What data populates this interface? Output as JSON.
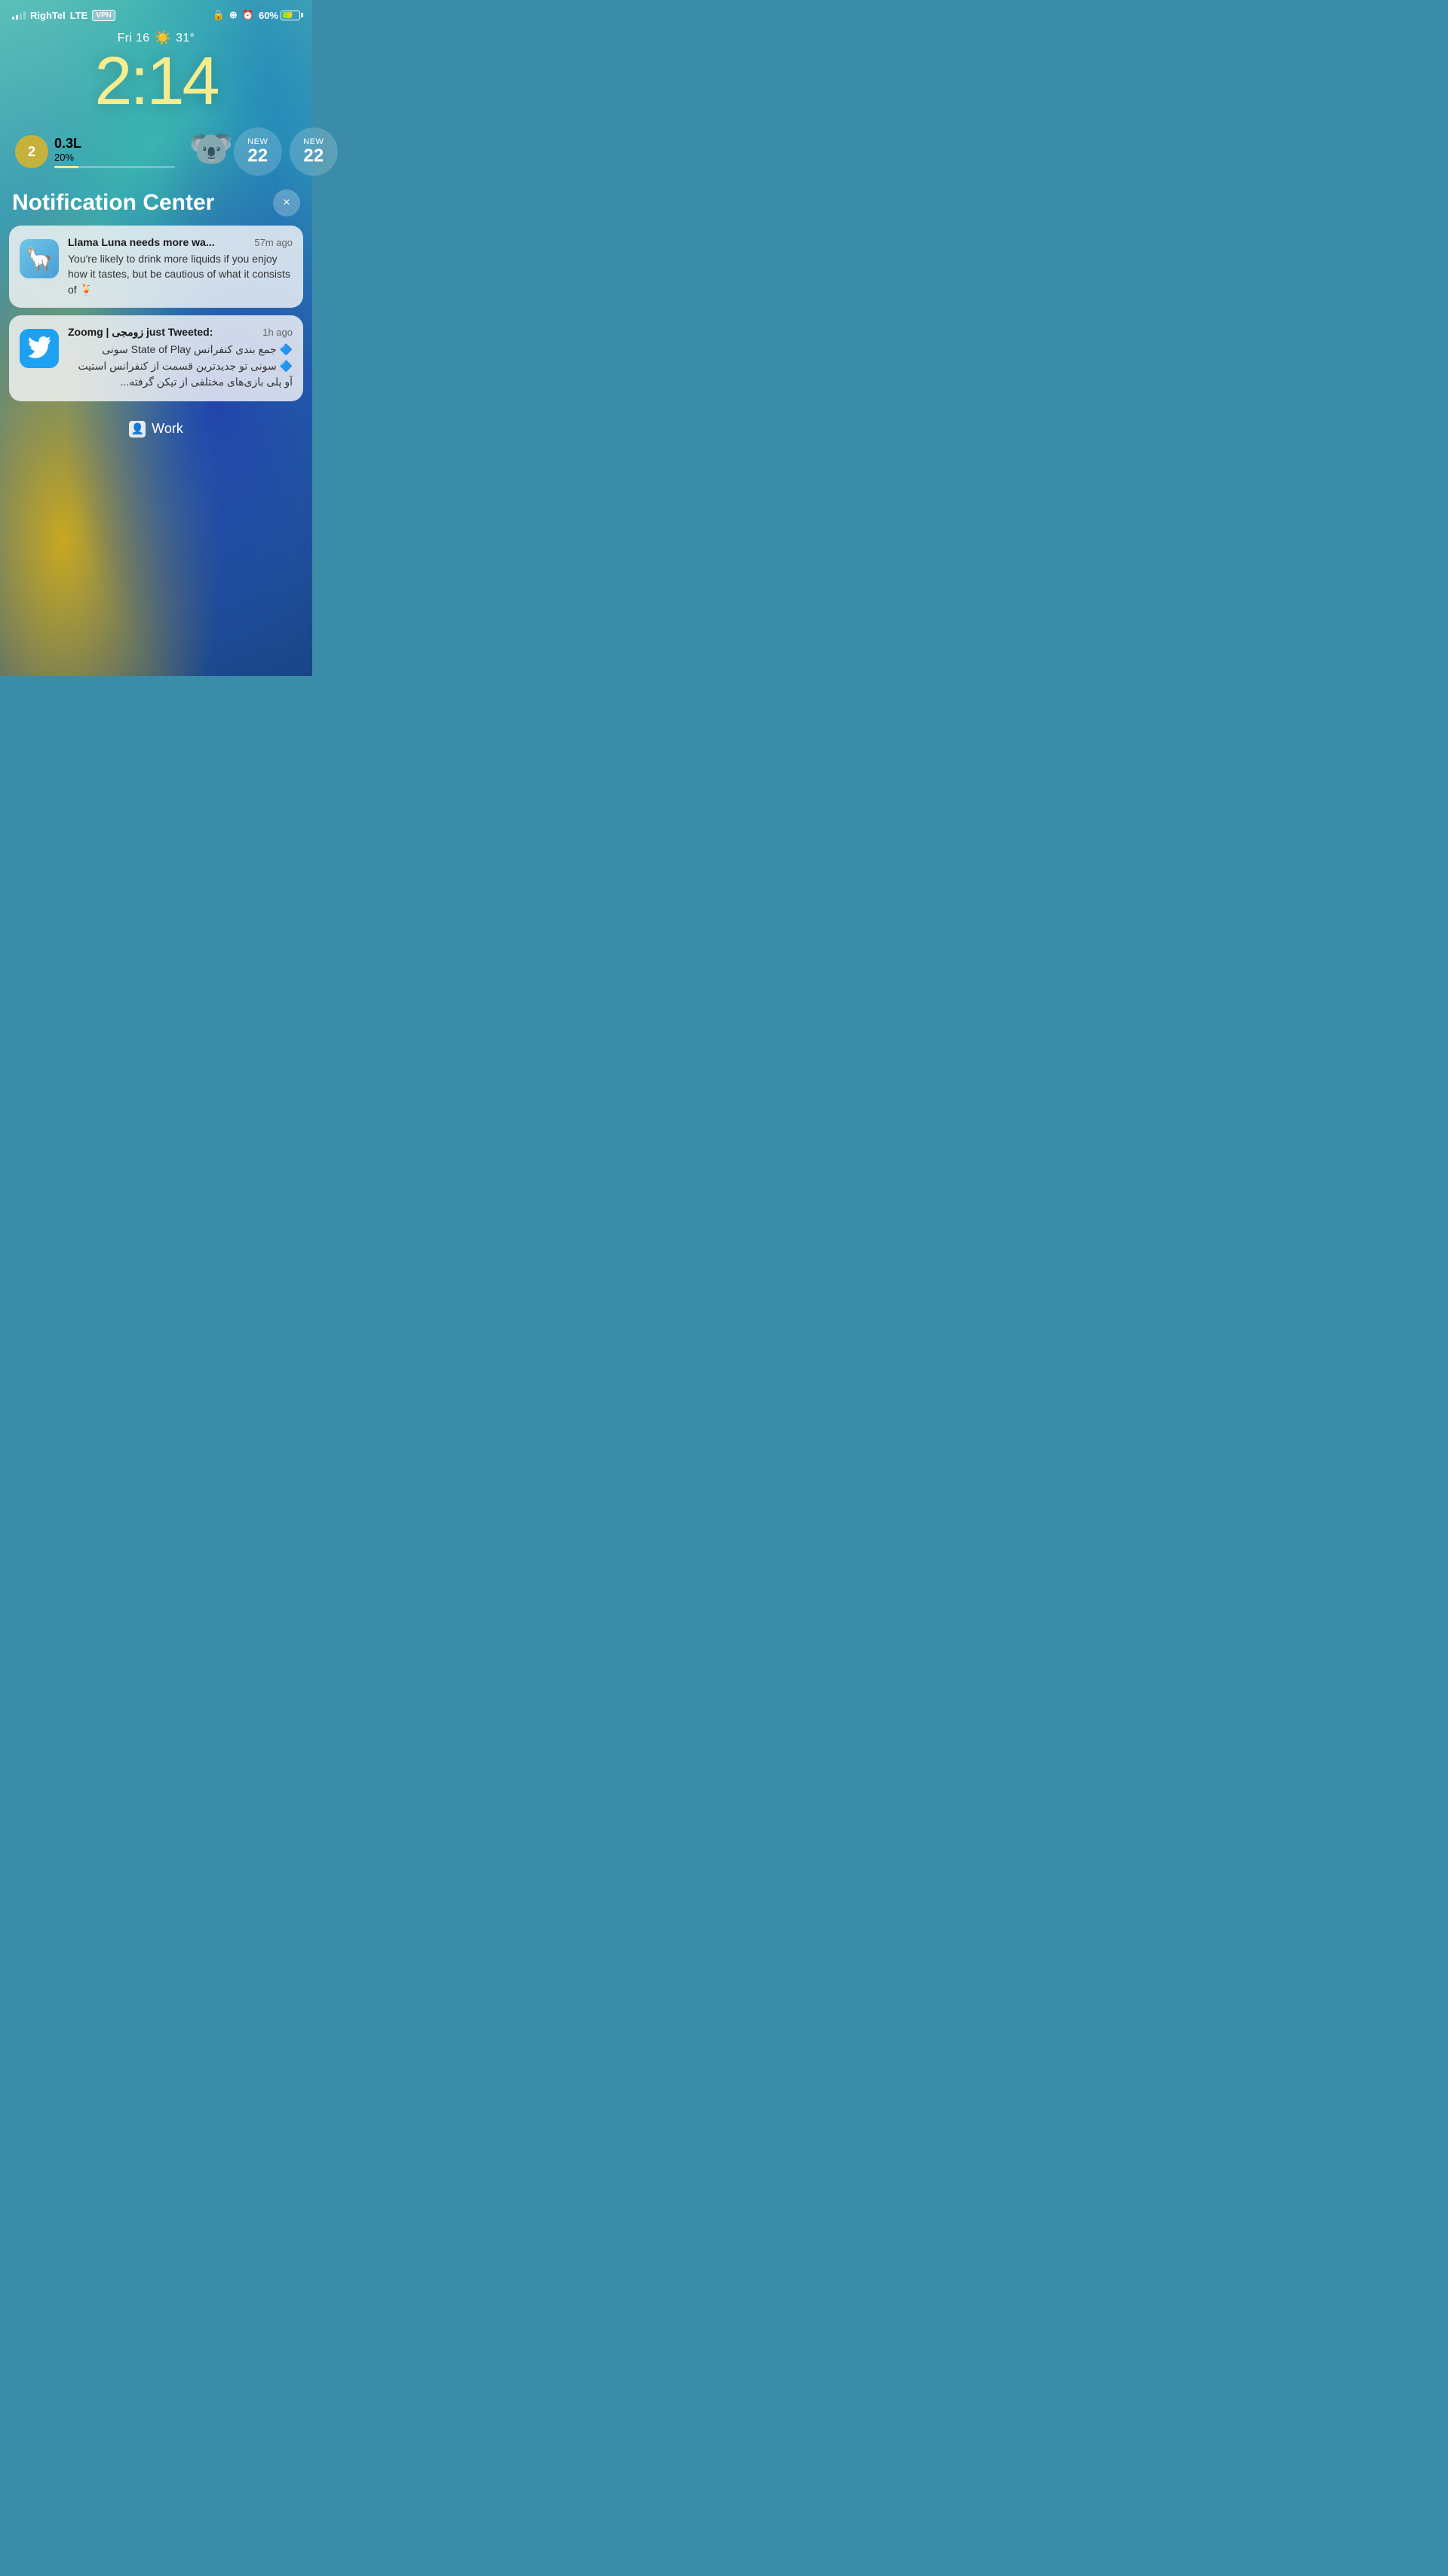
{
  "statusBar": {
    "carrier": "RighTel",
    "network": "LTE",
    "vpn": "VPN",
    "batteryPercent": "60%",
    "icons": [
      "🔒",
      "⊕",
      "⏰"
    ]
  },
  "lockScreen": {
    "date": "Fri 16",
    "temperature": "31°",
    "time": "2:14",
    "waterAmount": "0.3L",
    "waterPercent": "20%",
    "ringCount": "2",
    "widget1": {
      "label": "NEW",
      "count": "22"
    },
    "widget2": {
      "label": "NEW",
      "count": "22"
    }
  },
  "notificationCenter": {
    "title": "Notification Center",
    "closeButton": "×",
    "notifications": [
      {
        "appName": "Llama Luna needs more wa...",
        "time": "57m ago",
        "body": "You're likely to drink more liquids if you enjoy how it tastes, but be cautious of what it consists of 🍹",
        "icon": "llama",
        "rtl": false
      },
      {
        "appName": "Zoomg | زومجی just Tweeted:",
        "time": "1h ago",
        "bodyLine1": "🔷 جمع بندی کنفرانس State of Play سونی",
        "bodyLine2": "🔷 سونی تو جدیدترین قسمت از کنفرانس استیت آو پلی بازی‌های مختلفی از تیکن گرفته...",
        "icon": "twitter",
        "rtl": true
      }
    ]
  },
  "bottomBar": {
    "workLabel": "Work"
  }
}
